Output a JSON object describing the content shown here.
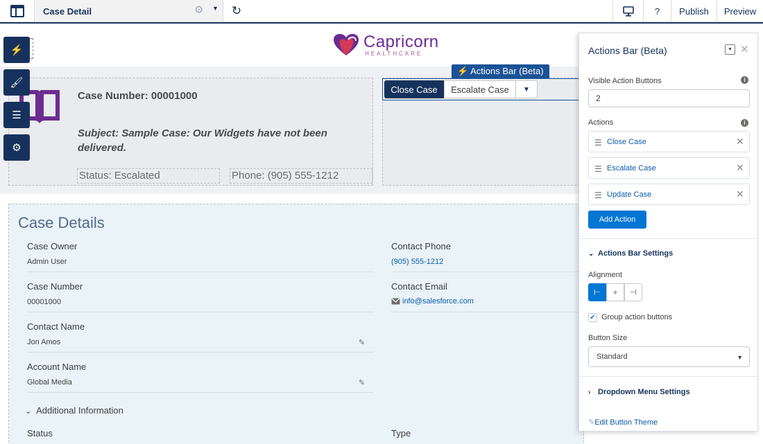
{
  "topbar": {
    "page_title": "Case Detail",
    "publish": "Publish",
    "preview": "Preview",
    "help": "?"
  },
  "logo": {
    "name": "Capricorn",
    "sub": "HEALTHCARE"
  },
  "header": {
    "case_number": "Case Number: 00001000",
    "subject": "Subject: Sample Case: Our Widgets have not been delivered.",
    "status": "Status: Escalated",
    "phone": "Phone: (905) 555-1212"
  },
  "actions_bar": {
    "tag": "Actions Bar (Beta)",
    "buttons": [
      "Close Case",
      "Escalate Case"
    ]
  },
  "details": {
    "title": "Case Details",
    "fields": [
      {
        "label": "Case Owner",
        "value": "Admin User"
      },
      {
        "label": "Case Number",
        "value": "00001000"
      },
      {
        "label": "Contact Name",
        "value": "Jon Amos"
      },
      {
        "label": "Account Name",
        "value": "Global Media"
      },
      {
        "label": "Contact Phone",
        "value": "(905) 555-1212"
      },
      {
        "label": "Contact Email",
        "value": "info@salesforce.com"
      }
    ],
    "additional_info": "Additional Information",
    "bottom_labels": [
      "Status",
      "Type"
    ]
  },
  "panel": {
    "title": "Actions Bar (Beta)",
    "visible_label": "Visible Action Buttons",
    "visible_value": "2",
    "actions_label": "Actions",
    "actions": [
      "Close Case",
      "Escalate Case",
      "Update Case"
    ],
    "add_action": "Add Action",
    "settings_section": "Actions Bar Settings",
    "alignment_label": "Alignment",
    "group_label": "Group action buttons",
    "group_checked": true,
    "size_label": "Button Size",
    "size_value": "Standard",
    "dropdown_section": "Dropdown Menu Settings",
    "edit_theme": "Edit Button Theme"
  },
  "colors": {
    "navy": "#16325c",
    "brand_blue": "#0176d3",
    "logo_purple": "#6b2c91"
  }
}
